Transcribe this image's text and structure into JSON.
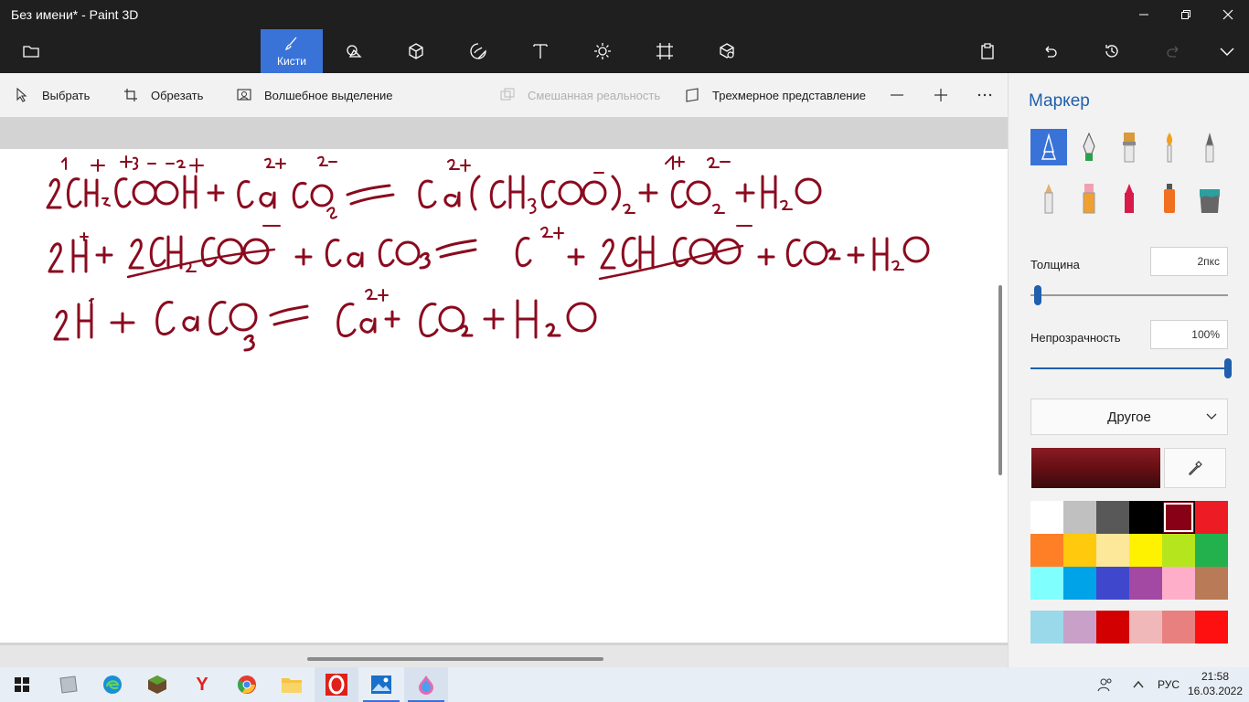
{
  "window": {
    "title": "Без имени* - Paint 3D"
  },
  "toolbar": {
    "active_label": "Кисти"
  },
  "subtoolbar": {
    "select": "Выбрать",
    "crop": "Обрезать",
    "magic_select": "Волшебное выделение",
    "mixed_reality": "Смешанная реальность",
    "view_3d": "Трехмерное представление"
  },
  "canvas": {
    "ink_color": "#8a0a1e",
    "handwriting": {
      "line1_lhs": "2CH₃COOH + CaCO₃",
      "line1_rhs": "Ca(CH₃COO)₂ + CO₂ + H₂O",
      "line2_lhs": "2H⁺ + 2CH₃COO⁻ + CaCO₃",
      "line2_rhs": "Ca²⁺ + 2CH₃COO⁻ + CO₂ + H₂O",
      "line3_lhs": "2H⁺ + CaCO₃",
      "line3_rhs": "Ca²⁺ + CO₂ + H₂O"
    }
  },
  "panel": {
    "title": "Маркер",
    "thickness_label": "Толщина",
    "thickness_value": "2пкс",
    "thickness_fraction": 0.02,
    "opacity_label": "Непрозрачность",
    "opacity_value": "100%",
    "opacity_fraction": 1.0,
    "palette_dropdown": "Другое",
    "current_color": "#7a1520",
    "swatches": [
      "#ffffff",
      "#c0c0c0",
      "#585858",
      "#000000",
      "#880015",
      "#ed1c24",
      "#ff7f27",
      "#ffc90e",
      "#fde89a",
      "#fff200",
      "#b5e61d",
      "#22b14c",
      "#80ffff",
      "#00a2e8",
      "#3f48cc",
      "#a349a4",
      "#ffaec9",
      "#b97a57"
    ],
    "selected_swatch_index": 4,
    "custom_swatches": [
      "#99d9ea",
      "#c8a0c8",
      "#d20000",
      "#f0b8b8",
      "#e88080",
      "#ff1010"
    ]
  },
  "taskbar": {
    "language": "РУС",
    "time": "21:58",
    "date": "16.03.2022"
  }
}
